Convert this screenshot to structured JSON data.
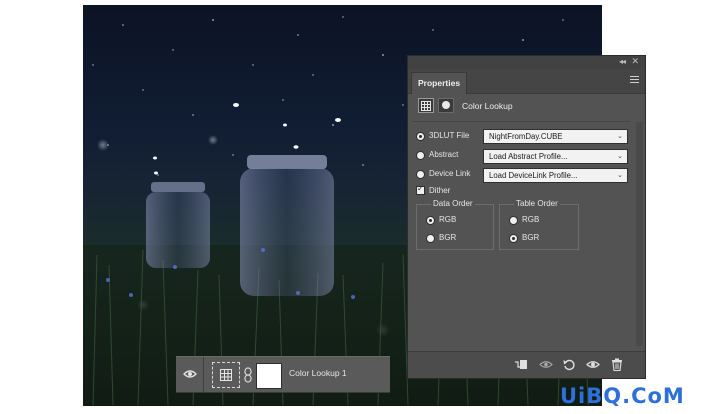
{
  "panel": {
    "tab_label": "Properties",
    "collapse_glyph": "◂◂",
    "close_glyph": "✕",
    "header_title": "Color Lookup",
    "rows": [
      {
        "label": "3DLUT File",
        "value": "NightFromDay.CUBE",
        "selected": true
      },
      {
        "label": "Abstract",
        "value": "Load Abstract Profile...",
        "selected": false
      },
      {
        "label": "Device Link",
        "value": "Load DeviceLink Profile...",
        "selected": false
      }
    ],
    "dither_label": "Dither",
    "dither_checked": true,
    "data_order": {
      "title": "Data Order",
      "options": [
        "RGB",
        "BGR"
      ],
      "selected": "RGB"
    },
    "table_order": {
      "title": "Table Order",
      "options": [
        "RGB",
        "BGR"
      ],
      "selected": "BGR"
    },
    "footer_icons": [
      "clip-to-layer-icon",
      "view-previous-state-icon",
      "reset-icon",
      "visibility-icon",
      "trash-icon"
    ]
  },
  "layer": {
    "name": "Color Lookup 1",
    "icons": [
      "visibility-icon",
      "adjustment-grid-icon",
      "chain-link-icon"
    ]
  },
  "watermark": "UiBQ.CoM",
  "colors": {
    "panel_bg": "#535353",
    "panel_dark": "#424242",
    "watermark": "#2e6fd8"
  }
}
